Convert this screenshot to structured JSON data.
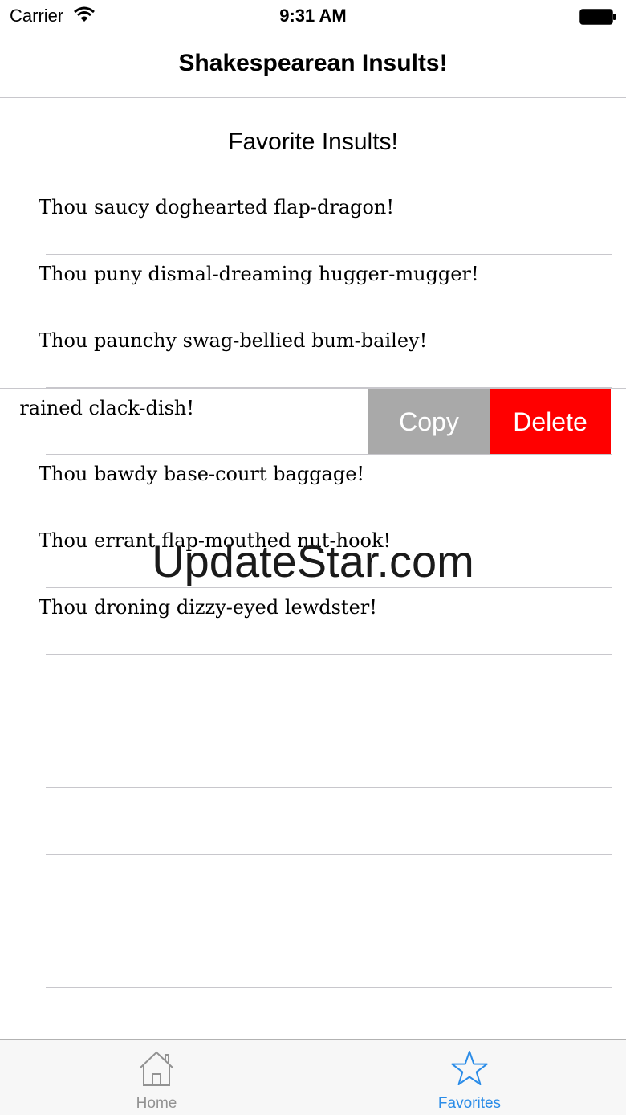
{
  "status_bar": {
    "carrier": "Carrier",
    "time": "9:31 AM"
  },
  "nav": {
    "title": "Shakespearean Insults!"
  },
  "section_title": "Favorite Insults!",
  "insults": [
    "Thou saucy doghearted flap-dragon!",
    "Thou puny dismal-dreaming hugger-mugger!",
    "Thou paunchy swag-bellied bum-bailey!",
    "rained clack-dish!",
    "Thou bawdy base-court baggage!",
    "Thou errant flap-mouthed nut-hook!",
    "Thou droning dizzy-eyed lewdster!"
  ],
  "swipe_actions": {
    "copy": "Copy",
    "delete": "Delete"
  },
  "colors": {
    "copy": "#a9a9a9",
    "delete": "#ff0000",
    "tab_active": "#2a8ce8",
    "tab_inactive": "#929292"
  },
  "watermark": "UpdateStar.com",
  "tabs": {
    "home": {
      "label": "Home",
      "icon": "house-icon"
    },
    "favorites": {
      "label": "Favorites",
      "icon": "star-icon"
    }
  }
}
